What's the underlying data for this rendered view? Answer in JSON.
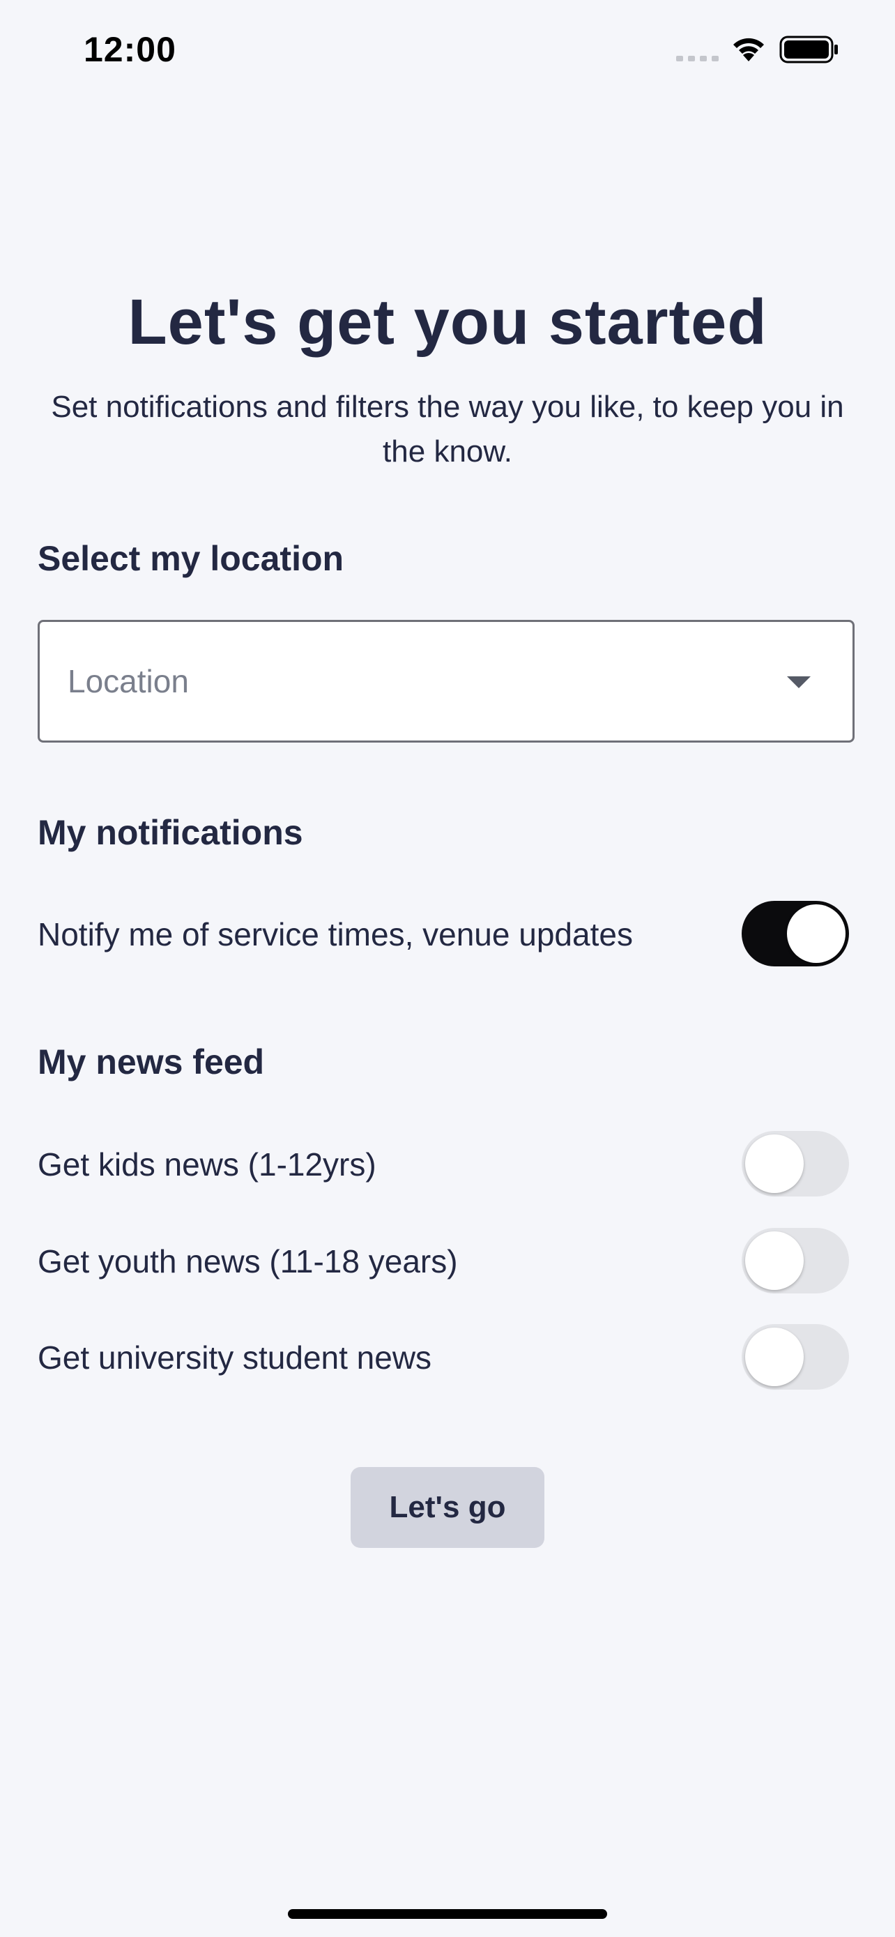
{
  "status_bar": {
    "time": "12:00"
  },
  "header": {
    "title": "Let's get you started",
    "subtitle": "Set notifications and filters the way you like, to keep you in the know."
  },
  "location": {
    "heading": "Select my location",
    "placeholder": "Location",
    "icon": "chevron-down-icon"
  },
  "notifications": {
    "heading": "My notifications",
    "items": [
      {
        "label": "Notify me of service times, venue updates",
        "enabled": true
      }
    ]
  },
  "news_feed": {
    "heading": "My news feed",
    "items": [
      {
        "label": "Get kids news (1-12yrs)",
        "enabled": false
      },
      {
        "label": "Get youth news (11-18 years)",
        "enabled": false
      },
      {
        "label": "Get university student news",
        "enabled": false
      }
    ]
  },
  "actions": {
    "primary_label": "Let's go"
  },
  "colors": {
    "background": "#f5f6fa",
    "text": "#232842",
    "toggle_on": "#0b0b0d",
    "toggle_off": "#e3e4e8",
    "button_bg": "#d2d4de"
  }
}
